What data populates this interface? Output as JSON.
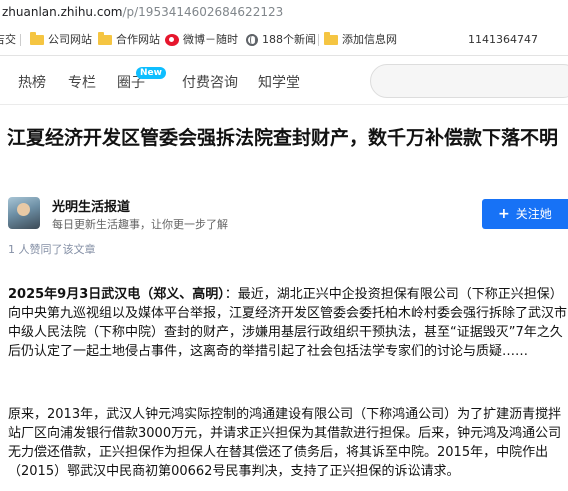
{
  "browser": {
    "url_host": "zhuanlan.zhihu.com",
    "url_path": "/p/1953414602684622123",
    "bookmarks": [
      {
        "label": "吉交",
        "icon": "none"
      },
      {
        "label": "公司网站",
        "icon": "folder-icon"
      },
      {
        "label": "合作网站",
        "icon": "folder-icon"
      },
      {
        "label": "微博－随时",
        "icon": "weibo-icon"
      },
      {
        "label": "188个新闻",
        "icon": "globe-icon"
      },
      {
        "label": "添加信息网",
        "icon": "folder-icon"
      },
      {
        "label": "1141364747",
        "icon": "none"
      }
    ]
  },
  "zhihu_nav": {
    "items": [
      "热榜",
      "专栏",
      "圈子",
      "付费咨询",
      "知学堂"
    ],
    "new_badge": "New"
  },
  "article": {
    "title": "江夏经济开发区管委会强拆法院查封财产，数千万补偿款下落不明",
    "author": {
      "name": "光明生活报道",
      "bio": "每日更新生活趣事，让你更一步了解"
    },
    "follow_label": "关注她",
    "likes": "1 人赞同了该文章",
    "paragraphs": [
      {
        "lead": "2025年9月3日武汉电（郑义、高明）",
        "text": "：最近，湖北正兴中企投资担保有限公司（下称正兴担保）向中央第九巡视组以及媒体平台举报，江夏经济开发区管委会委托柏木岭村委会强行拆除了武汉市中级人民法院（下称中院）查封的财产，涉嫌用基层行政组织干预执法，甚至“证据毁灭”7年之久后仍认定了一起土地侵占事件，这离奇的举措引起了社会包括法学专家们的讨论与质疑……"
      },
      {
        "lead": "",
        "text": "原来，2013年，武汉人钟元鸿实际控制的鸿通建设有限公司（下称鸿通公司）为了扩建沥青搅拌站厂区向浦发银行借款3000万元，并请求正兴担保为其借款进行担保。后来，钟元鸿及鸿通公司无力偿还借款，正兴担保作为担保人在替其偿还了债务后，将其诉至中院。2015年，中院作出（2015）鄂武汉中民商初第00662号民事判决，支持了正兴担保的诉讼请求。"
      }
    ]
  }
}
